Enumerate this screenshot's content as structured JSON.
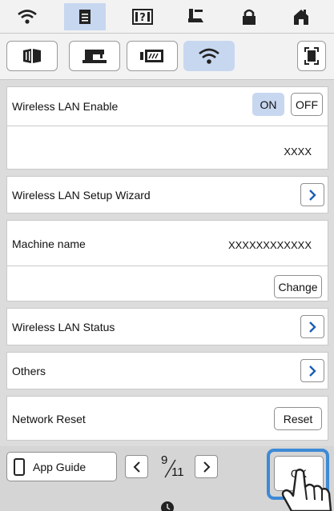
{
  "settings": {
    "wireless_enable_label": "Wireless LAN Enable",
    "on_label": "ON",
    "off_label": "OFF",
    "ssid_value": "XXXX",
    "setup_wizard_label": "Wireless LAN Setup Wizard",
    "machine_name_label": "Machine name",
    "machine_name_value": "XXXXXXXXXXXX",
    "change_label": "Change",
    "status_label": "Wireless LAN Status",
    "others_label": "Others",
    "network_reset_label": "Network Reset",
    "reset_label": "Reset"
  },
  "footer": {
    "app_guide_label": "App Guide",
    "page_current": "9",
    "page_total": "11",
    "ok_label": "OK"
  },
  "colors": {
    "selected": "#c8d7f0",
    "highlight": "#3d8ad6"
  }
}
